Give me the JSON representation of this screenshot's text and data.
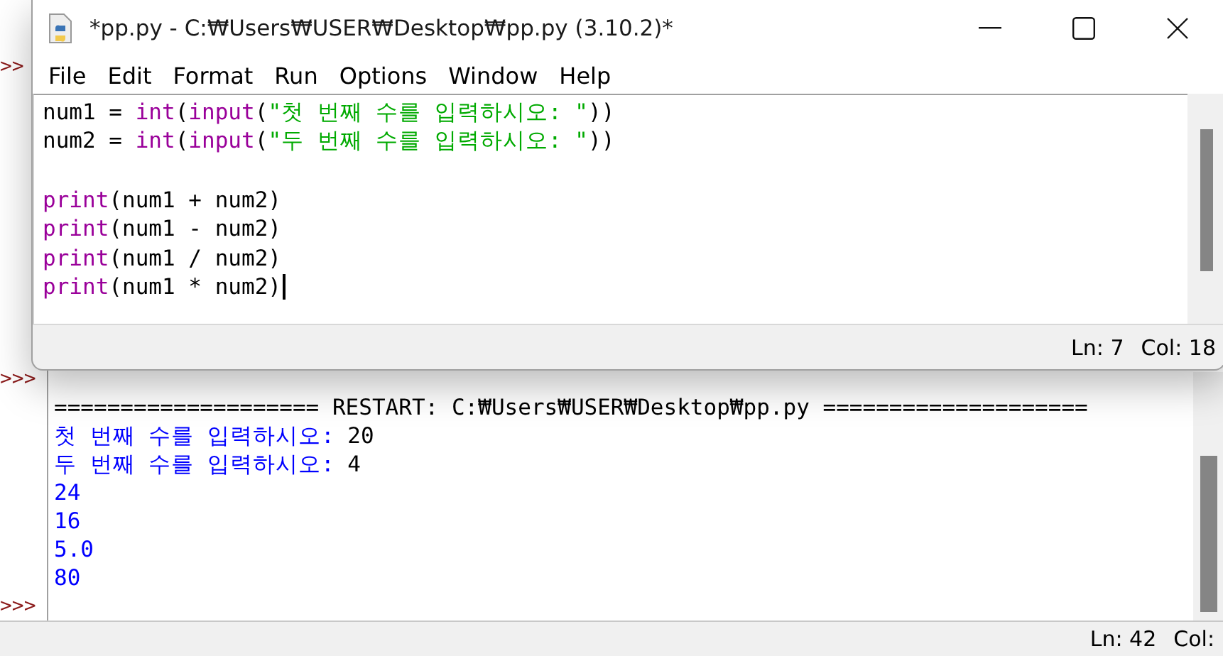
{
  "shell": {
    "lines": [
      {
        "kind": "prompt",
        "prompt": ">>"
      },
      {
        "kind": "prompt",
        "prompt": ">>>"
      },
      {
        "kind": "restart",
        "text": "==================== RESTART: C:₩Users₩USER₩Desktop₩pp.py ===================="
      },
      {
        "kind": "input",
        "text": "첫 번째 수를 입력하시오:",
        "value": "20"
      },
      {
        "kind": "input",
        "text": "두 번째 수를 입력하시오:",
        "value": "4"
      },
      {
        "kind": "output",
        "text": "24"
      },
      {
        "kind": "output",
        "text": "16"
      },
      {
        "kind": "output",
        "text": "5.0"
      },
      {
        "kind": "output",
        "text": "80"
      },
      {
        "kind": "prompt",
        "prompt": ">>>"
      }
    ],
    "status": {
      "line": "Ln: 42",
      "col": "Col:"
    }
  },
  "editor": {
    "title": "*pp.py - C:₩Users₩USER₩Desktop₩pp.py (3.10.2)*",
    "menu": [
      "File",
      "Edit",
      "Format",
      "Run",
      "Options",
      "Window",
      "Help"
    ],
    "code": [
      {
        "cursor": false,
        "tokens": [
          {
            "kind": "plain",
            "text": "num1 = "
          },
          {
            "kind": "builtin",
            "text": "int"
          },
          {
            "kind": "plain",
            "text": "("
          },
          {
            "kind": "builtin",
            "text": "input"
          },
          {
            "kind": "plain",
            "text": "("
          },
          {
            "kind": "string",
            "text": "\"첫 번째 수를 입력하시오: \""
          },
          {
            "kind": "plain",
            "text": "))"
          }
        ]
      },
      {
        "cursor": false,
        "tokens": [
          {
            "kind": "plain",
            "text": "num2 = "
          },
          {
            "kind": "builtin",
            "text": "int"
          },
          {
            "kind": "plain",
            "text": "("
          },
          {
            "kind": "builtin",
            "text": "input"
          },
          {
            "kind": "plain",
            "text": "("
          },
          {
            "kind": "string",
            "text": "\"두 번째 수를 입력하시오: \""
          },
          {
            "kind": "plain",
            "text": "))"
          }
        ]
      },
      {
        "cursor": false
      },
      {
        "cursor": false,
        "tokens": [
          {
            "kind": "builtin",
            "text": "print"
          },
          {
            "kind": "plain",
            "text": "(num1 + num2)"
          }
        ]
      },
      {
        "cursor": false,
        "tokens": [
          {
            "kind": "builtin",
            "text": "print"
          },
          {
            "kind": "plain",
            "text": "(num1 - num2)"
          }
        ]
      },
      {
        "cursor": false,
        "tokens": [
          {
            "kind": "builtin",
            "text": "print"
          },
          {
            "kind": "plain",
            "text": "(num1 / num2)"
          }
        ]
      },
      {
        "cursor": true,
        "tokens": [
          {
            "kind": "builtin",
            "text": "print"
          },
          {
            "kind": "plain",
            "text": "(num1 * num2)"
          }
        ]
      }
    ],
    "status": {
      "line": "Ln: 7",
      "col": "Col: 18"
    }
  }
}
